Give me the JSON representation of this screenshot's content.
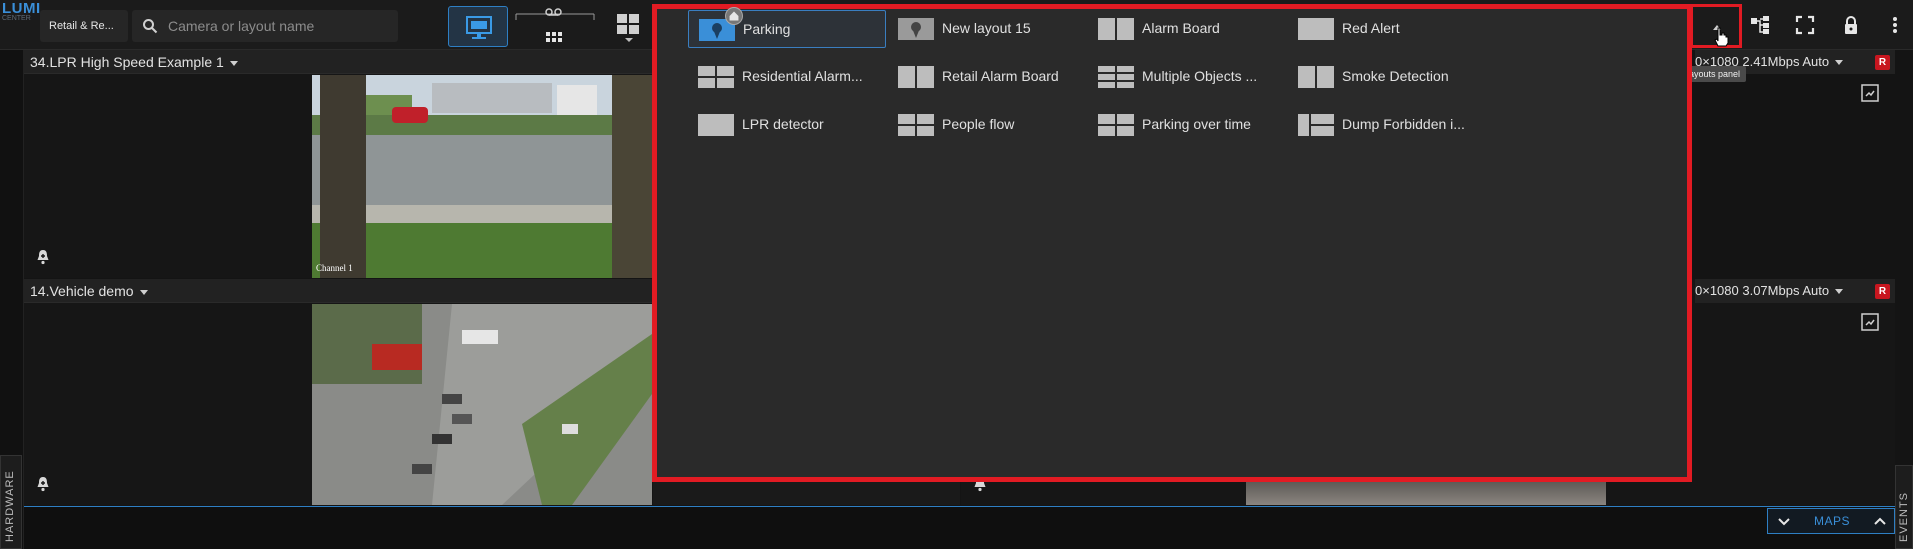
{
  "app": {
    "logo_main": "LUMI",
    "logo_sub": "CENTER"
  },
  "toolbar": {
    "site_label": "Retail & Re...",
    "search_placeholder": "Camera or layout name",
    "tooltip": "Layouts panel"
  },
  "cells": [
    {
      "title": "34.LPR High Speed Example 1",
      "stream": "0×1080 2.41Mbps Auto",
      "rec": "R",
      "overlay_text": "Channel 1"
    },
    {
      "title": "14.Vehicle demo",
      "stream": "0×1080 3.07Mbps Auto",
      "rec": "R"
    }
  ],
  "layouts": [
    {
      "name": "Parking",
      "thumb": "map-pin",
      "selected": true,
      "home": true
    },
    {
      "name": "New layout 15",
      "thumb": "map-pin"
    },
    {
      "name": "Alarm Board",
      "thumb": "grid-2"
    },
    {
      "name": "Red Alert",
      "thumb": "single"
    },
    {
      "name": "Residential Alarm...",
      "thumb": "grid-4"
    },
    {
      "name": "Retail Alarm Board",
      "thumb": "grid-2"
    },
    {
      "name": "Multiple Objects ...",
      "thumb": "grid-6"
    },
    {
      "name": "Smoke Detection",
      "thumb": "grid-2"
    },
    {
      "name": "LPR detector",
      "thumb": "single"
    },
    {
      "name": "People flow",
      "thumb": "grid-4"
    },
    {
      "name": "Parking over time",
      "thumb": "grid-4"
    },
    {
      "name": "Dump Forbidden i...",
      "thumb": "grid-3"
    }
  ],
  "side_tabs": {
    "left": "HARDWARE",
    "right": "EVENTS",
    "maps": "MAPS"
  },
  "colors": {
    "accent": "#2e7fc4",
    "highlight": "#e21b23",
    "panel": "#2a2a2a"
  }
}
